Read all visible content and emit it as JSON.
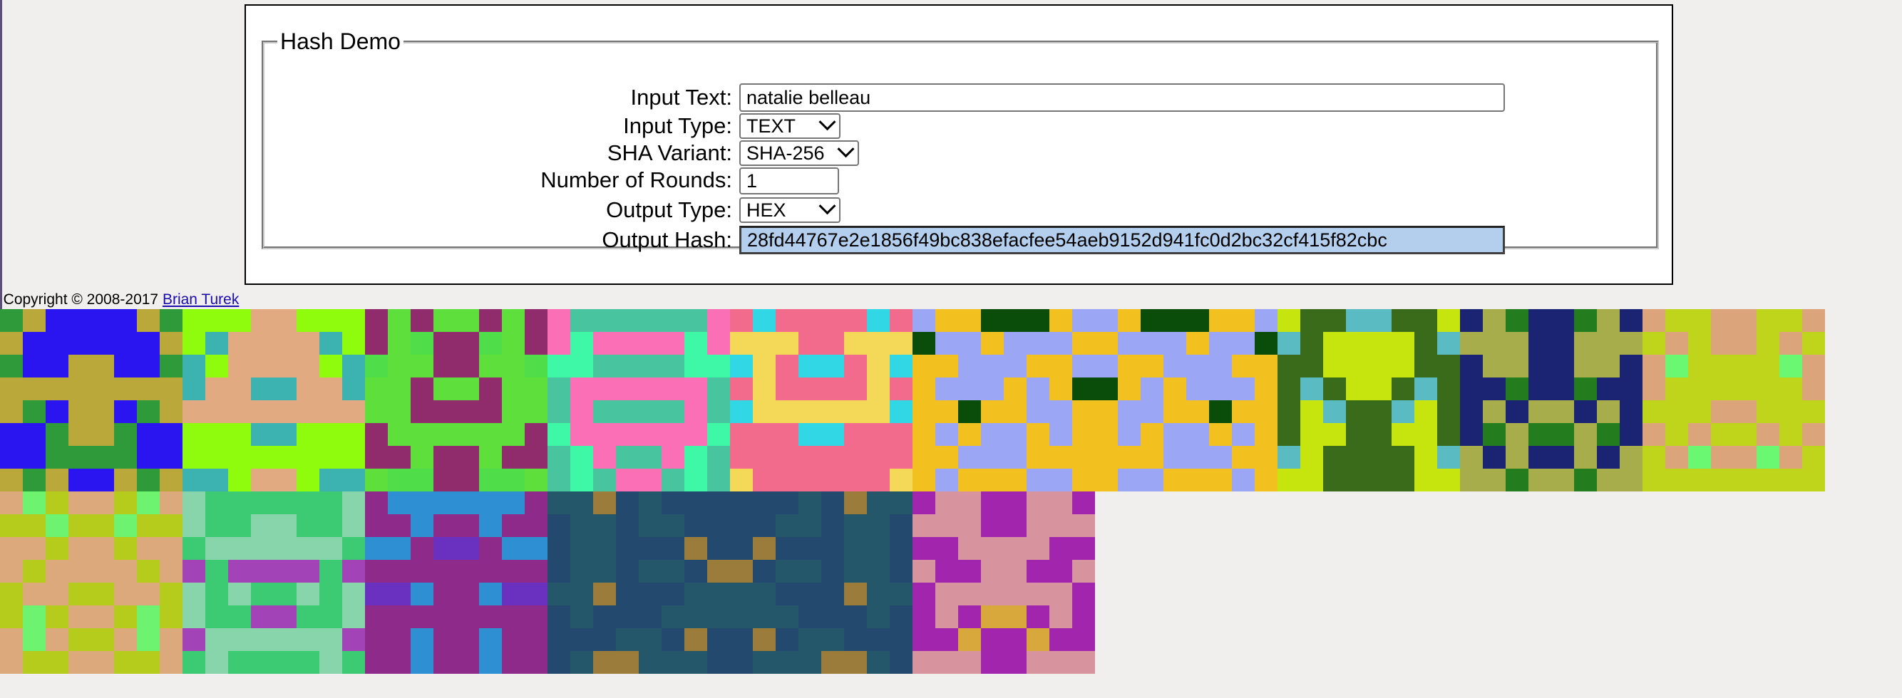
{
  "form": {
    "legend": "Hash Demo",
    "input_text_label": "Input Text:",
    "input_text_value": "natalie belleau",
    "input_type_label": "Input Type:",
    "input_type_value": "TEXT",
    "sha_variant_label": "SHA Variant:",
    "sha_variant_value": "SHA-256",
    "rounds_label": "Number of Rounds:",
    "rounds_value": "1",
    "output_type_label": "Output Type:",
    "output_type_value": "HEX",
    "output_hash_label": "Output Hash:",
    "output_hash_value": "28fd44767e2e1856f49bc838efacfee54aeb9152d941fc0d2bc32cf415f82cbc"
  },
  "footer": {
    "copyright_text": "Copyright © 2008-2017",
    "author_link": "Brian Turek"
  },
  "colors": {
    "output_highlight": "#b4cfee",
    "link": "#1a0dab"
  },
  "identicons": [
    {
      "name": "identicon-1",
      "colors": [
        "#2a14f0",
        "#bba83a",
        "#2f9a3a"
      ]
    },
    {
      "name": "identicon-2",
      "colors": [
        "#e2aa80",
        "#8ffc0e",
        "#3cb3b0"
      ]
    },
    {
      "name": "identicon-3",
      "colors": [
        "#5fdf3c",
        "#902c6c",
        "#4fdd4a"
      ]
    },
    {
      "name": "identicon-4",
      "colors": [
        "#48c49f",
        "#fb6fb6",
        "#3ef8a8"
      ]
    },
    {
      "name": "identicon-5",
      "colors": [
        "#f36b8c",
        "#f3d957",
        "#32d7e5"
      ]
    },
    {
      "name": "identicon-6",
      "colors": [
        "#9ba6f5",
        "#f2c01f",
        "#0a4d0a"
      ]
    },
    {
      "name": "identicon-7",
      "colors": [
        "#c6e50e",
        "#396b1a",
        "#5abbc3"
      ]
    },
    {
      "name": "identicon-8",
      "colors": [
        "#a8ad4b",
        "#1b2373",
        "#237d1e"
      ]
    },
    {
      "name": "identicon-9",
      "colors": [
        "#bed51b",
        "#dca47a",
        "#6af772"
      ]
    },
    {
      "name": "identicon-10",
      "colors": [
        "#b5cc1c",
        "#dba97c",
        "#6ef371"
      ]
    },
    {
      "name": "identicon-11",
      "colors": [
        "#89d5ab",
        "#3ccb72",
        "#a243b8"
      ]
    },
    {
      "name": "identicon-12",
      "colors": [
        "#8d2a8a",
        "#2e8fd2",
        "#6a30c0"
      ]
    },
    {
      "name": "identicon-13",
      "colors": [
        "#24576a",
        "#24496f",
        "#9c7c3a"
      ]
    },
    {
      "name": "identicon-14",
      "colors": [
        "#d7939e",
        "#a126ad",
        "#d8a83d"
      ]
    }
  ]
}
